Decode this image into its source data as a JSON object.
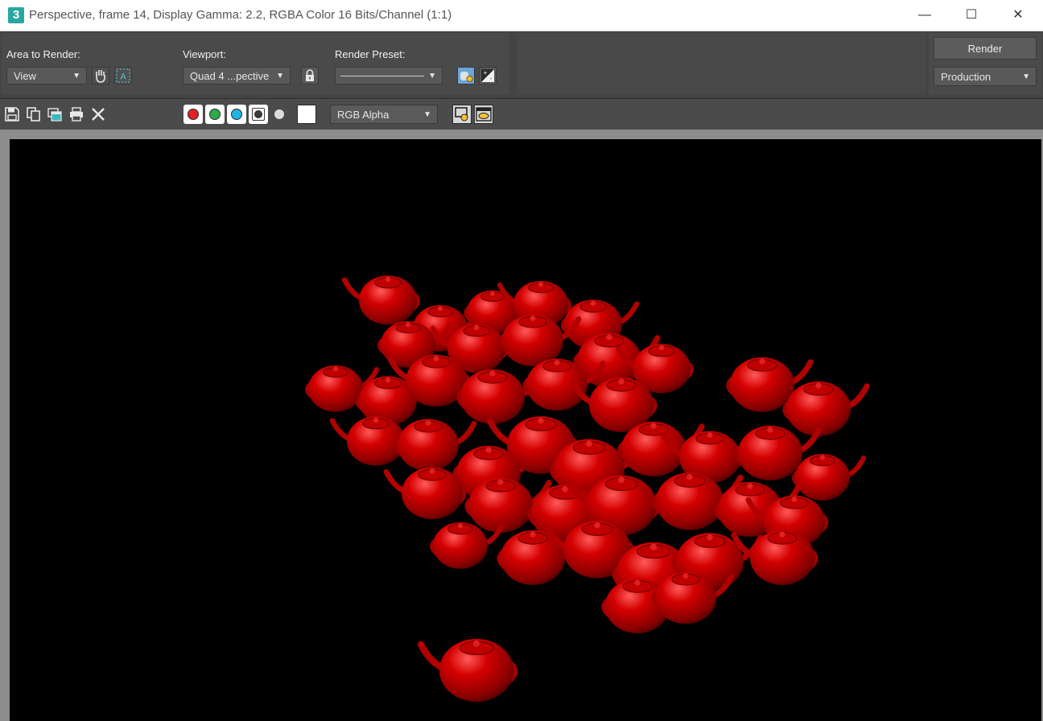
{
  "window": {
    "title": "Perspective, frame 14, Display Gamma: 2.2, RGBA Color 16 Bits/Channel (1:1)",
    "app_icon": "3",
    "minimize": "—",
    "maximize": "☐",
    "close": "✕"
  },
  "render_settings": {
    "area_label": "Area to Render:",
    "area_value": "View",
    "viewport_label": "Viewport:",
    "viewport_value": "Quad 4 ...pective",
    "preset_label": "Render Preset:",
    "preset_value": "",
    "render_button": "Render",
    "render_mode": "Production"
  },
  "toolbar": {
    "channel_display": "RGB Alpha",
    "icons": [
      "save-icon",
      "copy-icon",
      "clone-window-icon",
      "print-icon",
      "clear-icon"
    ],
    "channels": [
      {
        "name": "red",
        "color": "#e02424"
      },
      {
        "name": "green",
        "color": "#2fa84a"
      },
      {
        "name": "blue",
        "color": "#1fb4e6"
      },
      {
        "name": "alpha",
        "color": "#3c3c3c"
      },
      {
        "name": "monochrome",
        "color": "#dddddd"
      }
    ],
    "swatch_color": "#ffffff"
  },
  "render": {
    "background": "#000000",
    "object_color": "#c40000",
    "subject": "teapots"
  }
}
